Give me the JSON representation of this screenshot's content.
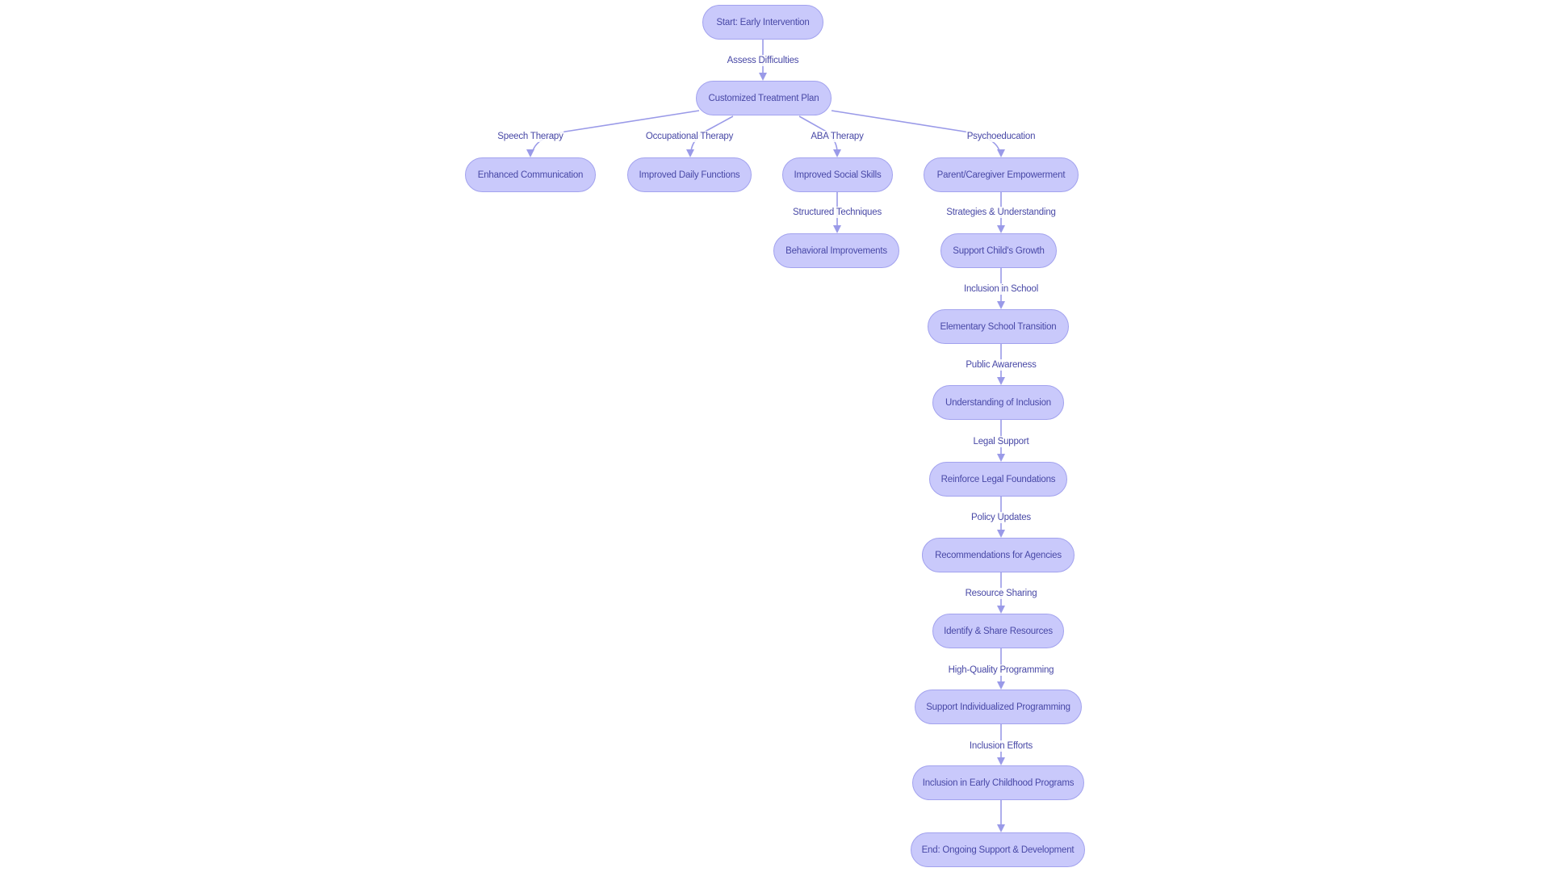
{
  "diagram": {
    "type": "flowchart",
    "colors": {
      "node_fill": "#c9c9fb",
      "node_stroke": "#a2a2ee",
      "text": "#4848a6",
      "edge": "#9a9ae8"
    },
    "nodes": [
      {
        "id": "start",
        "label": "Start: Early Intervention"
      },
      {
        "id": "plan",
        "label": "Customized Treatment Plan"
      },
      {
        "id": "comm",
        "label": "Enhanced Communication"
      },
      {
        "id": "daily",
        "label": "Improved Daily Functions"
      },
      {
        "id": "social",
        "label": "Improved Social Skills"
      },
      {
        "id": "parent",
        "label": "Parent/Caregiver Empowerment"
      },
      {
        "id": "behav",
        "label": "Behavioral Improvements"
      },
      {
        "id": "growth",
        "label": "Support Child's Growth"
      },
      {
        "id": "elem",
        "label": "Elementary School Transition"
      },
      {
        "id": "underst",
        "label": "Understanding of Inclusion"
      },
      {
        "id": "legal",
        "label": "Reinforce Legal Foundations"
      },
      {
        "id": "recs",
        "label": "Recommendations for Agencies"
      },
      {
        "id": "ident",
        "label": "Identify & Share Resources"
      },
      {
        "id": "indiv",
        "label": "Support Individualized Programming"
      },
      {
        "id": "early",
        "label": "Inclusion in Early Childhood Programs"
      },
      {
        "id": "end",
        "label": "End: Ongoing Support & Development"
      }
    ],
    "edges": [
      {
        "from": "start",
        "to": "plan",
        "label": "Assess Difficulties"
      },
      {
        "from": "plan",
        "to": "comm",
        "label": "Speech Therapy"
      },
      {
        "from": "plan",
        "to": "daily",
        "label": "Occupational Therapy"
      },
      {
        "from": "plan",
        "to": "social",
        "label": "ABA Therapy"
      },
      {
        "from": "plan",
        "to": "parent",
        "label": "Psychoeducation"
      },
      {
        "from": "social",
        "to": "behav",
        "label": "Structured Techniques"
      },
      {
        "from": "parent",
        "to": "growth",
        "label": "Strategies & Understanding"
      },
      {
        "from": "growth",
        "to": "elem",
        "label": "Inclusion in School"
      },
      {
        "from": "elem",
        "to": "underst",
        "label": "Public Awareness"
      },
      {
        "from": "underst",
        "to": "legal",
        "label": "Legal Support"
      },
      {
        "from": "legal",
        "to": "recs",
        "label": "Policy Updates"
      },
      {
        "from": "recs",
        "to": "ident",
        "label": "Resource Sharing"
      },
      {
        "from": "ident",
        "to": "indiv",
        "label": "High-Quality Programming"
      },
      {
        "from": "indiv",
        "to": "early",
        "label": "Inclusion Efforts"
      },
      {
        "from": "early",
        "to": "end",
        "label": ""
      }
    ]
  }
}
